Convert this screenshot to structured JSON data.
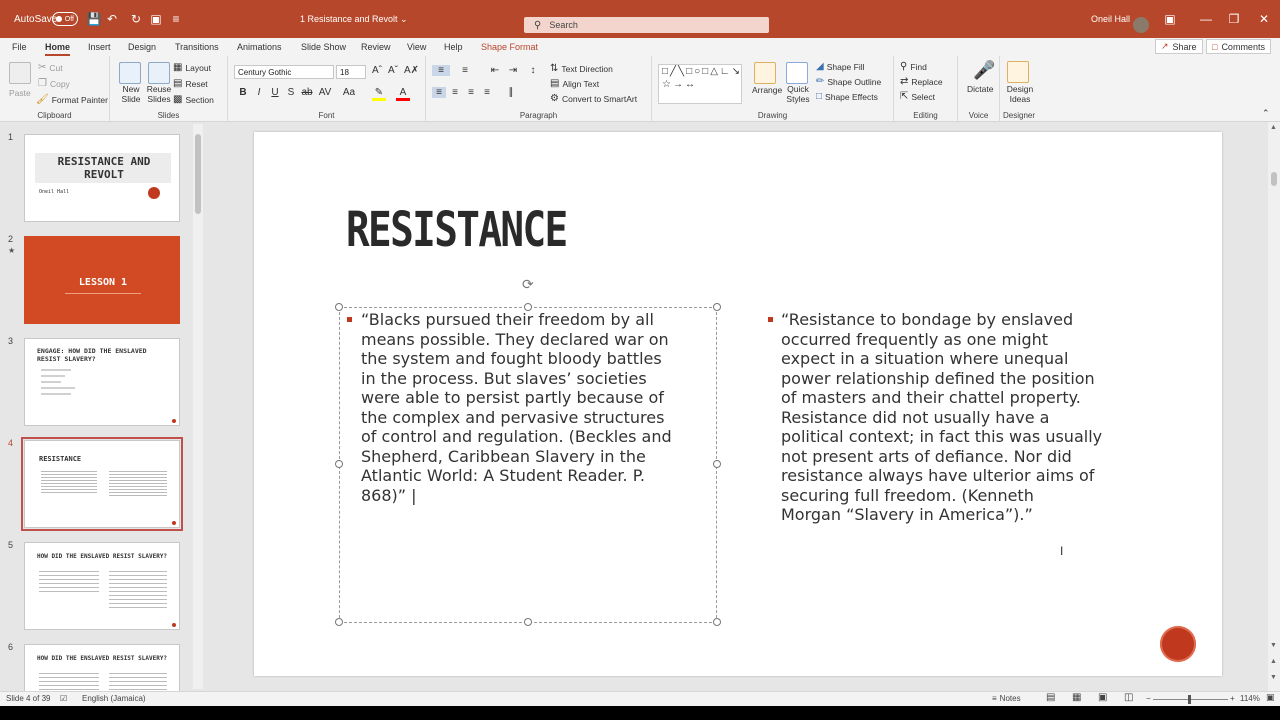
{
  "titlebar": {
    "autosave_label": "AutoSave",
    "autosave_state": "Off",
    "doc_title": "1 Resistance and Revolt  ⌄",
    "search_placeholder": "Search",
    "user_name": "Oneil Hall",
    "accent_color": "#b7472a"
  },
  "tabs": {
    "file": "File",
    "home": "Home",
    "insert": "Insert",
    "design": "Design",
    "transitions": "Transitions",
    "animations": "Animations",
    "slideshow": "Slide Show",
    "review": "Review",
    "view": "View",
    "help": "Help",
    "shape_format": "Shape Format",
    "share": "Share",
    "comments": "Comments"
  },
  "ribbon": {
    "clipboard": {
      "paste": "Paste",
      "cut": "Cut",
      "copy": "Copy",
      "format_painter": "Format Painter",
      "label": "Clipboard"
    },
    "slides": {
      "new_slide": "New Slide",
      "reuse_slides": "Reuse Slides",
      "layout": "Layout",
      "reset": "Reset",
      "section": "Section",
      "label": "Slides"
    },
    "font": {
      "font_name": "Century Gothic",
      "font_size": "18",
      "label": "Font"
    },
    "paragraph": {
      "text_direction": "Text Direction",
      "align_text": "Align Text",
      "smartart": "Convert to SmartArt",
      "label": "Paragraph"
    },
    "drawing": {
      "arrange": "Arrange",
      "quick_styles": "Quick Styles",
      "shape_fill": "Shape Fill",
      "shape_outline": "Shape Outline",
      "shape_effects": "Shape Effects",
      "label": "Drawing"
    },
    "editing": {
      "find": "Find",
      "replace": "Replace",
      "select": "Select",
      "label": "Editing"
    },
    "voice": {
      "dictate": "Dictate",
      "label": "Voice"
    },
    "designer": {
      "design_ideas": "Design Ideas",
      "label": "Designer"
    }
  },
  "thumbnails": [
    {
      "num": "1",
      "title": "RESISTANCE AND REVOLT",
      "subtitle": "Oneil Hall"
    },
    {
      "num": "2",
      "title": "LESSON 1"
    },
    {
      "num": "3",
      "title": "ENGAGE: HOW DID THE ENSLAVED RESIST SLAVERY?"
    },
    {
      "num": "4",
      "title": "RESISTANCE"
    },
    {
      "num": "5",
      "title": "HOW DID THE ENSLAVED RESIST SLAVERY?"
    },
    {
      "num": "6",
      "title": "HOW DID THE ENSLAVED RESIST SLAVERY?"
    }
  ],
  "slide": {
    "title": "RESISTANCE",
    "left_lines": [
      "“Blacks pursued their freedom by all",
      "means possible. They declared war on",
      "the system and fought bloody battles",
      "in the process. But slaves’ societies",
      "were able to persist partly because of",
      "the complex and pervasive structures",
      "of control and regulation. (Beckles and",
      "Shepherd, Caribbean Slavery in the",
      "Atlantic World: A Student Reader. P.",
      "868)” |"
    ],
    "right_lines": [
      "“Resistance to bondage by enslaved",
      "occurred frequently as one might",
      "expect in a situation where unequal",
      "power relationship defined the position",
      "of masters and their chattel property.",
      "Resistance did not usually have a",
      "political context; in fact this was usually",
      "not present arts of defiance. Nor did",
      "resistance always have ulterior aims of",
      "securing full freedom. (Kenneth",
      "Morgan “Slavery in America”).”"
    ],
    "bullet_color": "#c0391f"
  },
  "statusbar": {
    "slide_count": "Slide 4 of 39",
    "language": "English (Jamaica)",
    "notes": "Notes",
    "zoom": "114%"
  }
}
